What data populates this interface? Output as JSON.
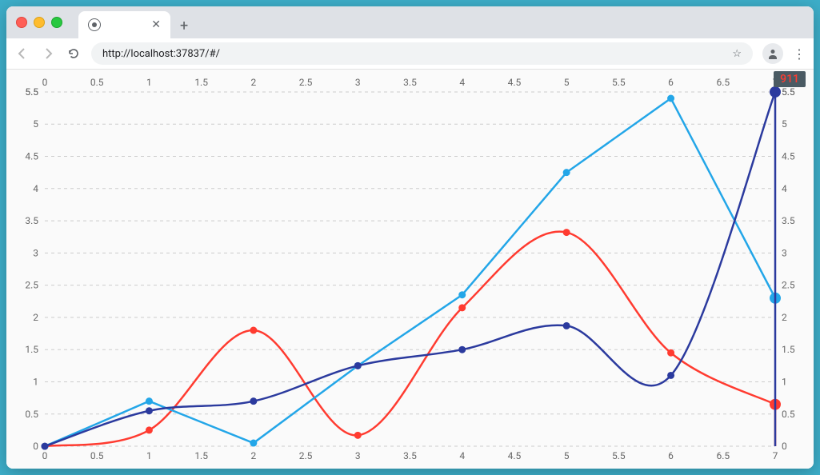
{
  "browser": {
    "url": "http://localhost:37837/#/",
    "tab_title": "",
    "traffic": [
      "close",
      "minimize",
      "zoom"
    ]
  },
  "tooltip": "911",
  "chart_data": {
    "type": "line",
    "x": [
      0,
      1,
      2,
      3,
      4,
      5,
      6,
      7
    ],
    "x_ticks_top": [
      0,
      0.5,
      1,
      1.5,
      2,
      2.5,
      3,
      3.5,
      4,
      4.5,
      5,
      5.5,
      6,
      6.5,
      7
    ],
    "x_ticks_bottom": [
      0,
      0.5,
      1,
      1.5,
      2,
      2.5,
      3,
      3.5,
      4,
      4.5,
      5,
      5.5,
      6,
      6.5,
      7
    ],
    "y_ticks_left": [
      0,
      0.5,
      1,
      1.5,
      2,
      2.5,
      3,
      3.5,
      4,
      4.5,
      5,
      5.5
    ],
    "y_ticks_right": [
      0,
      0.5,
      1,
      1.5,
      2,
      2.5,
      3,
      3.5,
      4,
      4.5,
      5,
      5.5
    ],
    "y_corner_overlap": "5.5",
    "ylim": [
      0,
      5.5
    ],
    "xlim": [
      0,
      7
    ],
    "series": [
      {
        "name": "red",
        "color": "#ff3b30",
        "style": "spline",
        "values": [
          0,
          0.25,
          1.8,
          0.17,
          2.15,
          3.32,
          1.45,
          0.65
        ],
        "highlight_end": true
      },
      {
        "name": "lightblue",
        "color": "#23a6e8",
        "style": "linear",
        "values": [
          0,
          0.7,
          0.05,
          1.25,
          2.35,
          4.25,
          5.4,
          2.3
        ],
        "highlight_end": true
      },
      {
        "name": "darkblue",
        "color": "#2b3a9e",
        "style": "spline",
        "values": [
          0,
          0.55,
          0.7,
          1.25,
          1.5,
          1.87,
          1.1,
          5.5
        ],
        "highlight_end": true
      }
    ]
  }
}
